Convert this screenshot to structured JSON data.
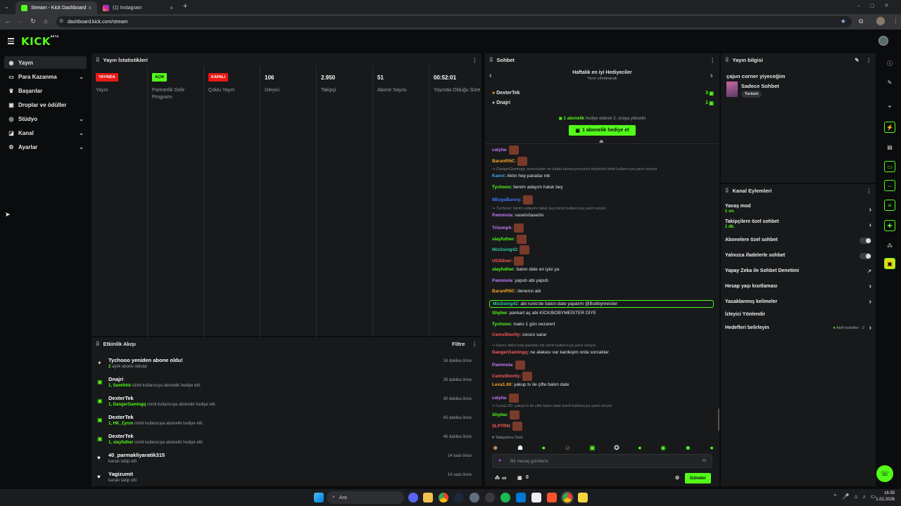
{
  "browser": {
    "tabs": [
      {
        "title": "Stream - Kick Dashboard",
        "close": "×"
      },
      {
        "title": "(1) Instagram",
        "close": "×"
      }
    ],
    "new_tab": "+",
    "url": "dashboard.kick.com/stream"
  },
  "header": {
    "logo": "KICK",
    "logo_tag": "BETA"
  },
  "sidebar": {
    "items": [
      {
        "label": "Yayın",
        "icon": "broadcast-icon",
        "active": true
      },
      {
        "label": "Para Kazanma",
        "icon": "money-icon",
        "chevron": true
      },
      {
        "label": "Başarılar",
        "icon": "trophy-icon"
      },
      {
        "label": "Droplar ve ödüller",
        "icon": "gift-icon"
      },
      {
        "label": "Stüdyo",
        "icon": "studio-icon",
        "chevron": true
      },
      {
        "label": "Kanal",
        "icon": "channel-icon",
        "chevron": true
      },
      {
        "label": "Ayarlar",
        "icon": "gear-icon",
        "chevron": true
      }
    ]
  },
  "stats": {
    "title": "Yayın İstatistikleri",
    "cells": [
      {
        "badge": "YAYINDA",
        "badge_color": "#e91916",
        "label": "Yayın"
      },
      {
        "badge": "AÇIK",
        "badge_color": "#53fc18",
        "label": "Partnerlik Gelir Programı"
      },
      {
        "badge": "KAPALI",
        "badge_color": "#e91916",
        "label": "Çoklu Yayın"
      },
      {
        "value": "106",
        "label": "İzleyici"
      },
      {
        "value": "2.950",
        "label": "Takipçi"
      },
      {
        "value": "51",
        "label": "Abone Sayısı"
      },
      {
        "value": "00:52:01",
        "label": "Yayında Olduğu Süre"
      }
    ]
  },
  "activity": {
    "title": "Etkinlik Akışı",
    "filter": "Filtre",
    "events": [
      {
        "icon": "sparkle-icon",
        "title": "Tychooo yeniden abone oldu!",
        "hl": "2",
        "sub": " aylık abone oldular",
        "time": "16 dakika önce"
      },
      {
        "icon": "gift-icon",
        "title": "Dnajri",
        "hl": "1, Semihhb",
        "sub": " isimli kullanıcıya abonelik hediye etti.",
        "time": "26 dakika önce"
      },
      {
        "icon": "gift-icon",
        "title": "DexterTek",
        "hl": "1, DangerGamingq",
        "sub": " isimli kullanıcıya abonelik hediye etti.",
        "time": "30 dakika önce"
      },
      {
        "icon": "gift-icon",
        "title": "DexterTek",
        "hl": "1, HK_Zyron",
        "sub": " isimli kullanıcıya abonelik hediye etti.",
        "time": "45 dakika önce"
      },
      {
        "icon": "gift-icon",
        "title": "DexterTek",
        "hl": "1, slayfuther",
        "sub": " isimli kullanıcıya abonelik hediye etti.",
        "time": "46 dakika önce"
      },
      {
        "icon": "heart-icon",
        "title": "40_parmakliyaratik315",
        "hl": "",
        "sub": "kanalı takip etti",
        "time": "14 saat önce"
      },
      {
        "icon": "heart-icon",
        "title": "Yagizumit",
        "hl": "",
        "sub": "kanalı takip etti",
        "time": "14 saat önce"
      }
    ]
  },
  "chat": {
    "title": "Sohbet",
    "gifters_title": "Haftalık en iyi Hediyeciler",
    "gifters_sub": "Yarın sıfırlanacak",
    "gifters": [
      {
        "name": "DexterTek",
        "count": "3"
      },
      {
        "name": "Dnajri",
        "count": "1"
      }
    ],
    "promo_hl": "1 abonelik",
    "promo_text": " hediye ederek 3. sıraya yükselin",
    "promo_button": "1 abonelik hediye et",
    "messages": [
      {
        "kind": "msg",
        "user": "calylia",
        "color": "#c77dff",
        "text": "",
        "emote": true
      },
      {
        "kind": "msg",
        "user": "BaranRNC",
        "color": "#f5a623",
        "text": "",
        "emote": true
      },
      {
        "kind": "reply",
        "text": "DangerGamingq: sunucudan ne kadar kazanıyorsunuz beyfendi isimli kullanıcıya yanıt veriyor"
      },
      {
        "kind": "msg",
        "user": "Kaovi",
        "color": "#3fa9f5",
        "text": ": Aklın hep paradaı mk"
      },
      {
        "kind": "msg",
        "user": "Tychooo",
        "color": "#53fc18",
        "text": ": benim adayım haluk bey"
      },
      {
        "kind": "msg",
        "user": "IIBugsBunny",
        "color": "#3f7bf5",
        "text": "",
        "emote": true
      },
      {
        "kind": "reply",
        "text": "Tychooo: benim adayım haluk bey isimli kullanıcıya yanıt veriyor"
      },
      {
        "kind": "msg",
        "user": "Pammola",
        "color": "#c77dff",
        "text": ": vaselvöaseöiv"
      },
      {
        "kind": "msg",
        "user": "Triiumph",
        "color": "#c77dff",
        "text": "",
        "emote": true
      },
      {
        "kind": "msg",
        "user": "slayfuther",
        "color": "#53fc18",
        "text": "",
        "emote": true
      },
      {
        "kind": "msg",
        "user": "MisSsing42",
        "color": "#2ecc9a",
        "text": "",
        "emote": true
      },
      {
        "kind": "msg",
        "user": "UGSilver",
        "color": "#ff5a5a",
        "text": "",
        "emote": true
      },
      {
        "kind": "msg",
        "user": "slayfuther",
        "color": "#53fc18",
        "text": ": balon date en iyisi ya"
      },
      {
        "kind": "msg",
        "user": "Pammola",
        "color": "#c77dff",
        "text": ": yapıdı abi yapıdı"
      },
      {
        "kind": "msg",
        "user": "BaranRNC",
        "color": "#f5a623",
        "text": ": denensi abi"
      },
      {
        "kind": "msg",
        "user": "MisSsing42",
        "color": "#2ecc9a",
        "text": ": abi runic'de balon date yapalım @Bobbymeister",
        "highlight": true
      },
      {
        "kind": "msg",
        "user": "Shybw",
        "color": "#53fc18",
        "text": ": pankart aç abi KİCK/BOBYMEİSTER DİYE"
      },
      {
        "kind": "msg",
        "user": "Tychooo",
        "color": "#53fc18",
        "text": ": maks 1 gün nezarert"
      },
      {
        "kind": "msg",
        "user": "Cems5hortly",
        "color": "#ff5a5a",
        "text": ": ooooo sarar"
      },
      {
        "kind": "reply",
        "text": "Kaovi: Aklın hep paradaı mk isimli kullanıcıya yanıt veriyor"
      },
      {
        "kind": "msg",
        "user": "DangerGamingq",
        "color": "#ff5a5a",
        "text": ": ne alakası var kardeşim orda sorcaklar"
      },
      {
        "kind": "msg",
        "user": "Pammola",
        "color": "#c77dff",
        "text": "",
        "emote": true
      },
      {
        "kind": "msg",
        "user": "Cems5hortly",
        "color": "#ff5a5a",
        "text": "",
        "emote": true
      },
      {
        "kind": "msg",
        "user": "Lexa1.60",
        "color": "#f5a623",
        "text": ": yakup tv ile çifte balon date"
      },
      {
        "kind": "msg",
        "user": "calylia",
        "color": "#c77dff",
        "text": "",
        "emote": true
      },
      {
        "kind": "reply",
        "text": "Lexa1.60: yakup tv ile çifte balon date isimli kullanıcıya yanıt veriyor"
      },
      {
        "kind": "msg",
        "user": "Shybw",
        "color": "#53fc18",
        "text": "",
        "emote": true
      },
      {
        "kind": "msg",
        "user": "3LPTRN",
        "color": "#ff5a5a",
        "text": "",
        "emote": true
      }
    ],
    "followers_only": "Takipçilere Özel",
    "input_placeholder": "Bir mesaj gönderin",
    "points": "∞",
    "gift_count": "0",
    "send": "Gönder"
  },
  "stream_info": {
    "title": "Yayın bilgisi",
    "stream_title": "çajun corner yiyeceğim",
    "category": "Sadece Sohbet",
    "language": "Turkish"
  },
  "channel_actions": {
    "title": "Kanal Eylemleri",
    "items": [
      {
        "label": "Yavaş mod",
        "sub": "1 sn.",
        "control": "arrow"
      },
      {
        "label": "Takipçilere özel sohbet",
        "sub": "1 dk.",
        "control": "arrow"
      },
      {
        "label": "Abonelere özel sohbet",
        "sub": "",
        "control": "toggle"
      },
      {
        "label": "Yalnızca ifadelerle sohbet",
        "sub": "",
        "control": "toggle"
      },
      {
        "label": "Yapay Zeka ile Sohbet Denetimi",
        "sub": "",
        "control": "link"
      },
      {
        "label": "Hesap yaşı kısıtlaması",
        "sub": "",
        "control": "arrow"
      },
      {
        "label": "Yasaklanmış kelimeler",
        "sub": "",
        "control": "arrow"
      },
      {
        "label": "İzleyici Yönlendir",
        "sub": "",
        "control": "none"
      },
      {
        "label": "Hedefleri belirleyin",
        "sub": "",
        "control": "arrow",
        "extra": "Aktif hedefler - 2"
      }
    ]
  },
  "taskbar": {
    "search": "Ara",
    "time": "16:35",
    "date": "1.02.2026"
  },
  "colors": {
    "accent": "#53fc18",
    "live": "#e91916",
    "panel": "#17191b",
    "bg": "#0b0c0d"
  }
}
